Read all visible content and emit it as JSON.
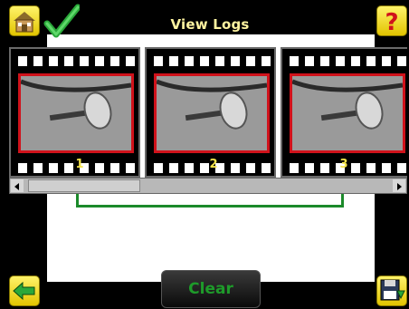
{
  "header": {
    "title": "View Logs"
  },
  "icons": {
    "home": "home-icon",
    "check": "checkmark-icon",
    "help": "question-mark-icon",
    "back": "back-arrow-icon",
    "save": "save-disk-icon"
  },
  "film_strip": {
    "frames": [
      {
        "label": "1"
      },
      {
        "label": "2"
      },
      {
        "label": "3"
      }
    ]
  },
  "scroll": {
    "position": 0.0
  },
  "footer": {
    "clear_label": "Clear"
  },
  "colors": {
    "title": "#fff4a0",
    "frame_border": "#d0121b",
    "frame_number": "#f3e34a",
    "accent_green": "#1b8a2a",
    "button_yellow": "#f3d600"
  }
}
